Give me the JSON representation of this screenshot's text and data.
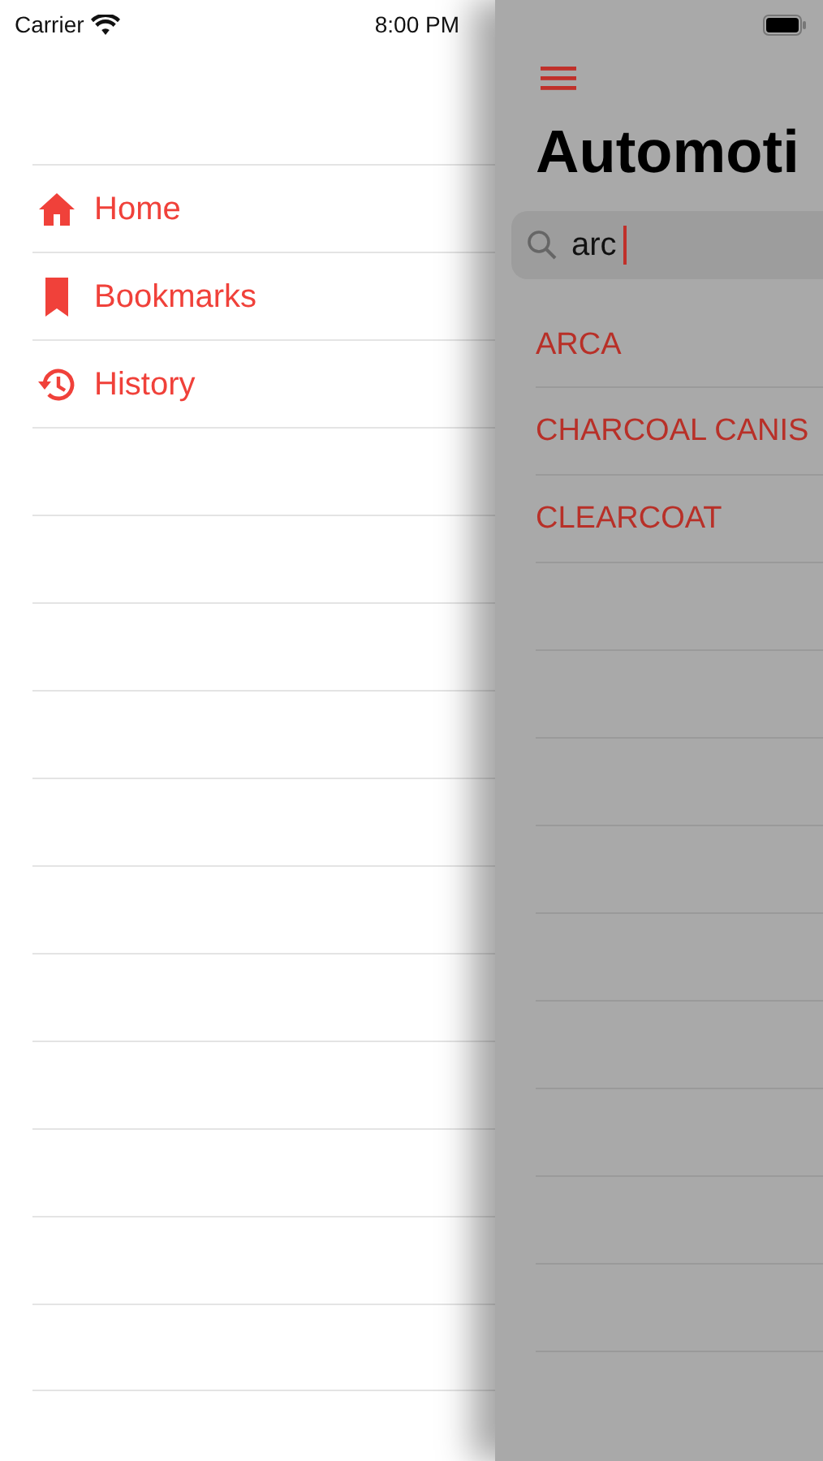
{
  "status_bar": {
    "carrier": "Carrier",
    "time": "8:00 PM"
  },
  "drawer": {
    "items": [
      {
        "kind": "home",
        "label": "Home"
      },
      {
        "kind": "bookmark",
        "label": "Bookmarks"
      },
      {
        "kind": "history",
        "label": "History"
      }
    ]
  },
  "main": {
    "title": "Automoti",
    "search": {
      "value": "arc"
    },
    "results": [
      "ARCA",
      "CHARCOAL CANIS",
      "CLEARCOAT"
    ]
  }
}
